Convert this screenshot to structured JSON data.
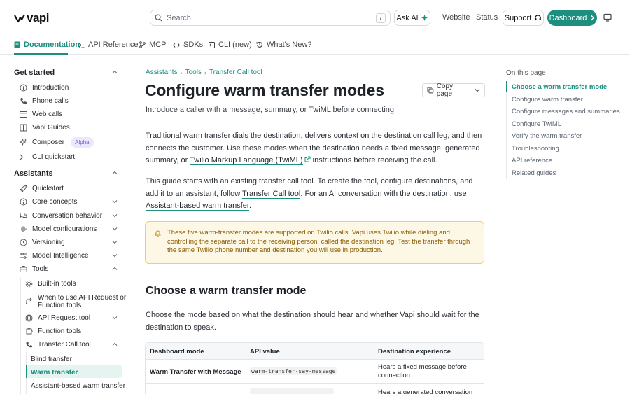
{
  "header": {
    "logo_text": "vapi",
    "search_placeholder": "Search",
    "search_shortcut": "/",
    "ask_ai": "Ask AI",
    "links": [
      "Website",
      "Status"
    ],
    "support": "Support",
    "dashboard": "Dashboard"
  },
  "tabs": [
    "Documentation",
    "API Reference",
    "MCP",
    "SDKs",
    "CLI (new)",
    "What's New?"
  ],
  "sidebar": {
    "get_started": "Get started",
    "get_started_items": [
      "Introduction",
      "Phone calls",
      "Web calls",
      "Vapi Guides",
      "Composer",
      "CLI quickstart"
    ],
    "composer_badge": "Alpha",
    "assistants": "Assistants",
    "assistants_items": [
      "Quickstart",
      "Core concepts",
      "Conversation behavior",
      "Model configurations",
      "Versioning",
      "Model Intelligence",
      "Tools"
    ],
    "tools_items": [
      "Built-in tools",
      "When to use API Request or",
      "Function tools",
      "API Request tool",
      "Function tools",
      "Transfer Call tool"
    ],
    "transfer_items": [
      "Blind transfer",
      "Warm transfer",
      "Assistant-based warm transfer"
    ]
  },
  "breadcrumb": [
    "Assistants",
    "Tools",
    "Transfer Call tool"
  ],
  "page": {
    "title": "Configure warm transfer modes",
    "subtitle": "Introduce a caller with a message, summary, or TwiML before connecting",
    "copy_page": "Copy page",
    "p1_a": "Traditional warm transfer dials the destination, delivers context on the destination call leg, and then connects the customer. Use these modes when the destination needs a fixed message, generated summary, or ",
    "p1_link": "Twilio Markup Language (TwiML)",
    "p1_b": " instructions before receiving the call.",
    "p2_a": "This guide starts with an existing transfer call tool. To create the tool, configure destinations, and add it to an assistant, follow ",
    "p2_link1": "Transfer Call tool",
    "p2_b": ". For an AI conversation with the destination, use ",
    "p2_link2": "Assistant-based warm transfer",
    "p2_c": ".",
    "callout": "These five warm-transfer modes are supported on Twilio calls. Vapi uses Twilio while dialing and controlling the separate call to the receiving person, called the destination leg. Test the transfer through the same Twilio phone number and destination you will use in production.",
    "h2": "Choose a warm transfer mode",
    "p3": "Choose the mode based on what the destination should hear and whether Vapi should wait for the destination to speak.",
    "table_headers": [
      "Dashboard mode",
      "API value",
      "Destination experience"
    ],
    "row1": [
      "Warm Transfer with Message",
      "warm-transfer-say-message",
      "Hears a fixed message before connection"
    ],
    "row2_partial": "Hears a generated conversation"
  },
  "toc": {
    "title": "On this page",
    "items": [
      "Choose a warm transfer mode",
      "Configure warm transfer",
      "Configure messages and summaries",
      "Configure TwiML",
      "Verify the warm transfer",
      "Troubleshooting",
      "API reference",
      "Related guides"
    ]
  },
  "colors": {
    "accent": "#1c8f7e",
    "callout_bg": "#fdf8e6",
    "callout_border": "#f0cf6b"
  }
}
